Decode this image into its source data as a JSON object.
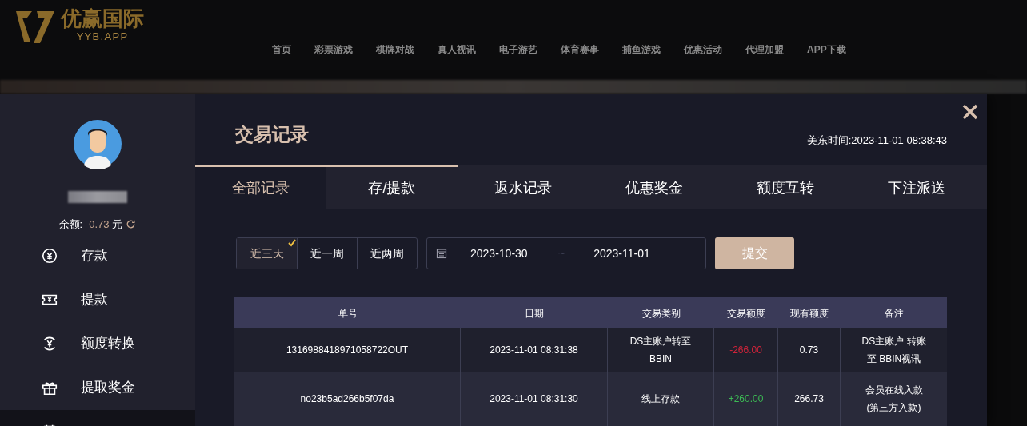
{
  "background": {
    "logo": {
      "name": "优赢国际",
      "domain": "YYB.APP"
    },
    "nav": [
      "首页",
      "彩票游戏",
      "棋牌对战",
      "真人视讯",
      "电子游艺",
      "体育赛事",
      "捕鱼游戏",
      "优惠活动",
      "代理加盟",
      "APP下载"
    ]
  },
  "sidebar": {
    "balance_label": "余额:",
    "balance": "0.73",
    "currency": "元",
    "items": [
      {
        "kind": "deposit",
        "label": "存款",
        "selected": false
      },
      {
        "kind": "withdraw",
        "label": "提款",
        "selected": false
      },
      {
        "kind": "transfer",
        "label": "额度转换",
        "selected": false
      },
      {
        "kind": "gift",
        "label": "提取奖金",
        "selected": false
      },
      {
        "kind": "records",
        "selected": true
      }
    ]
  },
  "main": {
    "title": "交易记录",
    "time_label": "美东时间:",
    "time": "2023-11-01 08:38:43",
    "tabs": [
      {
        "label": "全部记录",
        "selected": true,
        "topline": true
      },
      {
        "label": "存/提款",
        "selected": false,
        "topline": true
      },
      {
        "label": "返水记录",
        "selected": false,
        "topline": false
      },
      {
        "label": "优惠奖金",
        "selected": false,
        "topline": false
      },
      {
        "label": "额度互转",
        "selected": false,
        "topline": false
      },
      {
        "label": "下注派送",
        "selected": false,
        "topline": false
      }
    ],
    "ranges": [
      {
        "label": "近三天",
        "selected": true
      },
      {
        "label": "近一周",
        "selected": false
      },
      {
        "label": "近两周",
        "selected": false
      }
    ],
    "date_from": "2023-10-30",
    "date_sep": "~",
    "date_to": "2023-11-01",
    "submit": "提交",
    "table": {
      "columns": [
        "单号",
        "日期",
        "交易类别",
        "交易额度",
        "现有额度",
        "备注"
      ],
      "rows": [
        {
          "id": "1316988418971058722OUT",
          "date": "2023-11-01 08:31:38",
          "type": "DS主账户转至BBIN",
          "amount": "-266.00",
          "color": "#d0233a",
          "balance": "0.73",
          "note": "DS主账户 转账至 BBIN视讯"
        },
        {
          "id": "no23b5ad266b5f07da",
          "date": "2023-11-01 08:31:30",
          "type": "线上存款",
          "amount": "+260.00",
          "color": "#3cba54",
          "balance": "266.73",
          "note": "会员在线入款(第三方入款)"
        }
      ]
    }
  }
}
